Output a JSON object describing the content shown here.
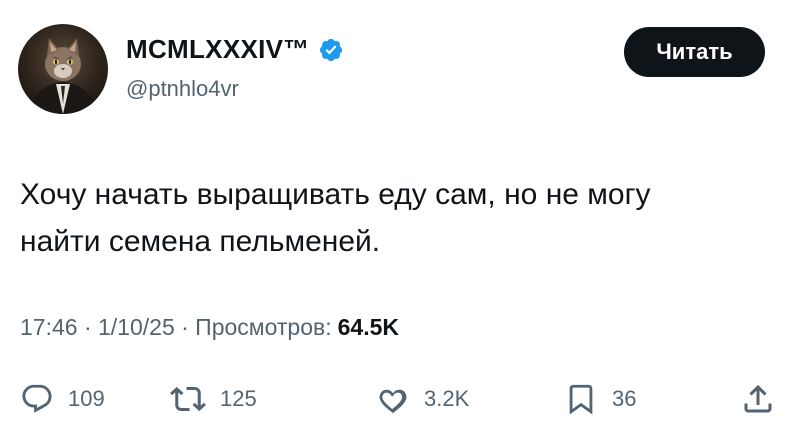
{
  "author": {
    "display_name": "MCMLXXXIV™",
    "handle": "@ptnhlo4vr",
    "verified": true,
    "avatar_description": "cat in a suit"
  },
  "read_button_label": "Читать",
  "tweet": {
    "line1": "Хочу начать выращивать еду сам, но не могу",
    "line2": "найти семена пельменей."
  },
  "meta": {
    "timestamp": "17:46 · 1/10/25 · Просмотров:",
    "views": "64.5K"
  },
  "actions": {
    "replies": "109",
    "reposts": "125",
    "likes": "3.2K",
    "bookmarks": "36"
  },
  "colors": {
    "text": "#0f1419",
    "secondary": "#536471",
    "verified": "#1d9bf0",
    "button_bg": "#0f1419"
  },
  "icons": [
    "verified-badge-icon",
    "reply-icon",
    "repost-icon",
    "like-icon",
    "bookmark-icon",
    "share-icon"
  ]
}
